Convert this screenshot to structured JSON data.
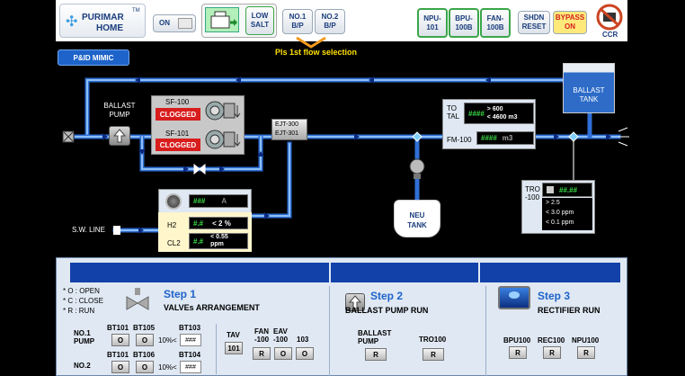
{
  "brand": {
    "name_line1": "PURIMAR",
    "name_line2": "HOME",
    "tm": "TM"
  },
  "toolbar": {
    "power": "ON",
    "low_salt": "LOW\nSALT",
    "no1_bp": "NO.1\nB/P",
    "no2_bp": "NO.2\nB/P",
    "npu": "NPU-\n101",
    "bpu": "BPU-\n100B",
    "fan": "FAN-\n100B",
    "shdn": "SHDN\nRESET",
    "bypass": "BYPASS\nON",
    "ccr": "CCR"
  },
  "flow_notice": "Pls 1st flow selection",
  "mimic_tab": "P&ID MIMIC",
  "mimic": {
    "ballast_pump": "BALLAST\nPUMP",
    "sf100": "SF-100",
    "sf101": "SF-101",
    "clogged1": "CLOGGED",
    "clogged2": "CLOGGED",
    "ejt300": "EJT-300",
    "ejt301": "EJT-301",
    "total_label": "TO\nTAL",
    "total_value": "####",
    "total_hi": "> 600",
    "total_lo": "< 4600 m3",
    "fm_label": "FM-100",
    "fm_value": "####",
    "fm_unit": "m3",
    "ballast_tank": "BALLAST\nTANK",
    "neu_tank": "NEU\nTANK",
    "sw_line": "S.W. LINE",
    "sensor_value": "###",
    "sensor_unit": "A",
    "h2_label": "H2",
    "h2_value": "#.#",
    "h2_limit": "< 2 %",
    "cl2_label": "CL2",
    "cl2_value": "#.#",
    "cl2_limit": "< 0.55\nppm",
    "tro_label": "TRO\n-100",
    "tro_value": "##.##",
    "tro_l1": "> 2.5",
    "tro_l2": "< 3.0 ppm",
    "tro_l3": "< 0.1 ppm"
  },
  "legend": {
    "open": "* O : OPEN",
    "close": "* C : CLOSE",
    "run": "* R : RUN"
  },
  "step1": {
    "title": "Step 1",
    "subtitle": "VALVEs ARRANGEMENT",
    "no1_pump": "NO.1\nPUMP",
    "no2": "NO.2",
    "bt101": "BT101",
    "bt105": "BT105",
    "bt103": "BT103",
    "bt101b": "BT101",
    "bt106": "BT106",
    "bt104": "BT104",
    "o": "O",
    "pct1": "10%<",
    "pct2": "10%<",
    "hash": "###",
    "tav": "TAV",
    "tav_val": "101",
    "fan": "FAN\n-100",
    "eav": "EAV\n-100",
    "col103": "103",
    "r": "R"
  },
  "step2": {
    "title": "Step 2",
    "subtitle": "BALLAST PUMP RUN",
    "ballast_pump": "BALLAST\nPUMP",
    "tro100": "TRO100",
    "r": "R"
  },
  "step3": {
    "title": "Step 3",
    "subtitle": "RECTIFIER RUN",
    "bpu100": "BPU100",
    "rec100": "REC100",
    "npu100": "NPU100",
    "r": "R"
  },
  "colors": {
    "pipe": "#2f6fd6",
    "pipe_light": "#7fb3ee",
    "panel": "#dfe8f3",
    "accent": "#1f63c9",
    "lcd": "#3be04a",
    "alarm": "#d81d1d"
  }
}
